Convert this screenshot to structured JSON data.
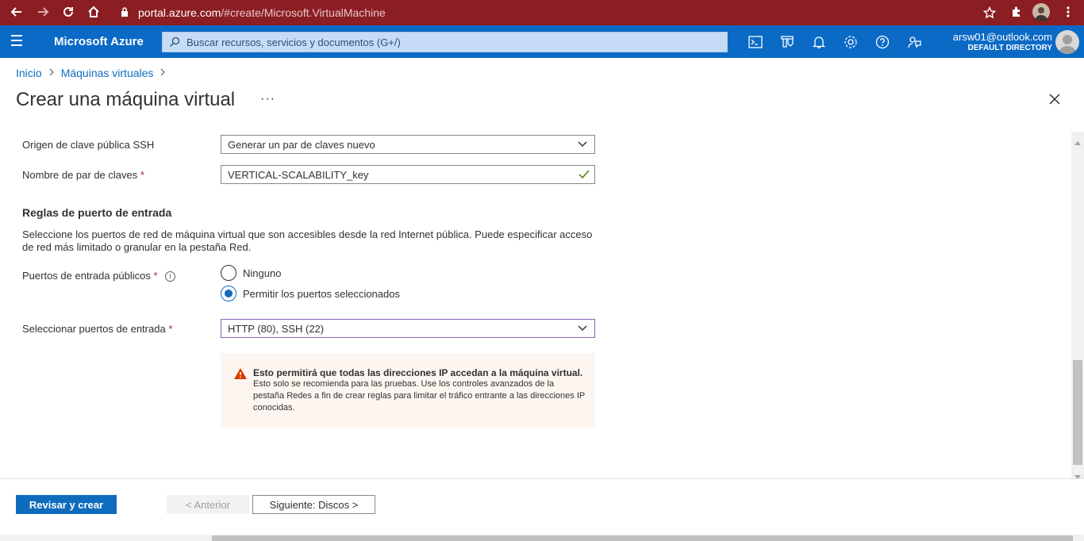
{
  "browser": {
    "url_host": "portal.azure.com",
    "url_path": "/#create/Microsoft.VirtualMachine"
  },
  "azure": {
    "brand": "Microsoft Azure",
    "search_placeholder": "Buscar recursos, servicios y documentos (G+/)",
    "account_email": "arsw01@outlook.com",
    "account_directory": "DEFAULT DIRECTORY",
    "top_icons": [
      "cloud-shell-icon",
      "directory-filter-icon",
      "notifications-icon",
      "settings-icon",
      "help-icon",
      "feedback-icon"
    ]
  },
  "breadcrumb": {
    "items": [
      "Inicio",
      "Máquinas virtuales"
    ]
  },
  "page": {
    "title": "Crear una máquina virtual",
    "more": "···"
  },
  "form": {
    "ssh_source_label": "Origen de clave pública SSH",
    "ssh_source_value": "Generar un par de claves nuevo",
    "key_name_label": "Nombre de par de claves",
    "key_name_value": "VERTICAL-SCALABILITY_key",
    "required_mark": "*",
    "section_heading": "Reglas de puerto de entrada",
    "section_desc": "Seleccione los puertos de red de máquina virtual que son accesibles desde la red Internet pública. Puede especificar acceso de red más limitado o granular en la pestaña Red.",
    "public_ports_label": "Puertos de entrada públicos",
    "radio_none": "Ninguno",
    "radio_allow": "Permitir los puertos seleccionados",
    "select_ports_label": "Seleccionar puertos de entrada",
    "select_ports_value": "HTTP (80), SSH (22)"
  },
  "warning": {
    "title": "Esto permitirá que todas las direcciones IP accedan a la máquina virtual.",
    "body": " Esto solo se recomienda para las pruebas.  Use los controles avanzados de la pestaña Redes a fin de crear reglas para limitar el tráfico entrante a las direcciones IP conocidas.",
    "color": "#d83b01"
  },
  "footer": {
    "review_create": "Revisar y crear",
    "previous": "< Anterior",
    "next": "Siguiente: Discos >"
  },
  "colors": {
    "browser_bar": "#8b1e22",
    "azure_bar": "#0b6ac6",
    "primary": "#0f6cbd"
  }
}
